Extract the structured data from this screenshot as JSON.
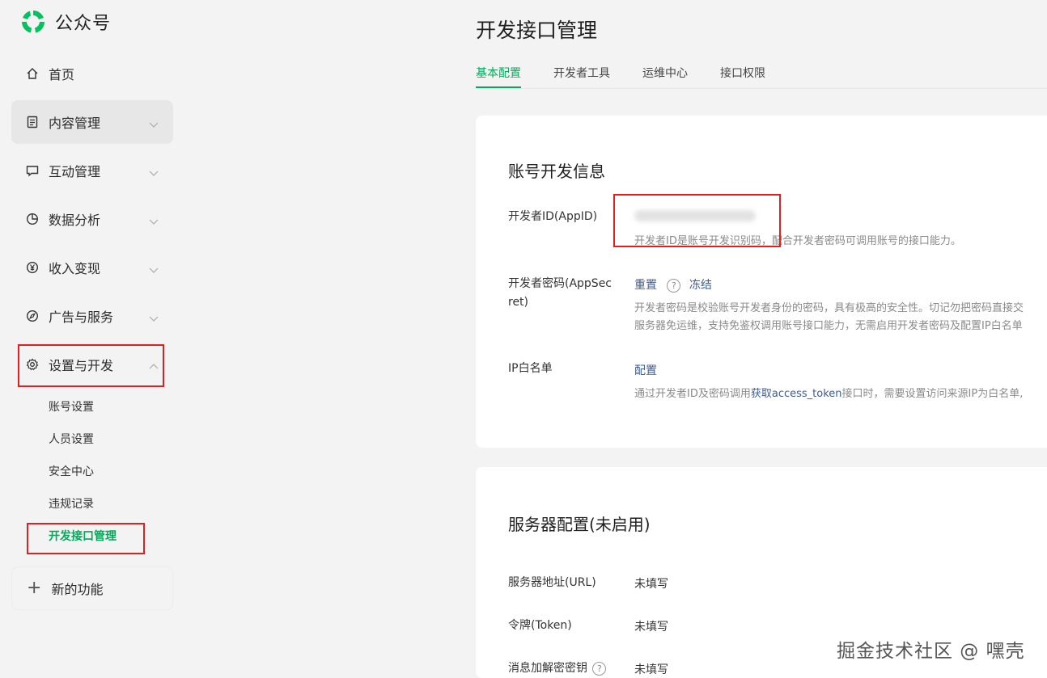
{
  "app": {
    "name": "公众号",
    "brand_color": "#07a85b"
  },
  "sidebar": {
    "items": [
      {
        "label": "首页",
        "icon": "home-icon"
      },
      {
        "label": "内容管理",
        "icon": "document-icon"
      },
      {
        "label": "互动管理",
        "icon": "chat-icon"
      },
      {
        "label": "数据分析",
        "icon": "pie-chart-icon"
      },
      {
        "label": "收入变现",
        "icon": "yen-icon"
      },
      {
        "label": "广告与服务",
        "icon": "compass-icon"
      },
      {
        "label": "设置与开发",
        "icon": "gear-icon"
      }
    ],
    "sub_items": [
      "账号设置",
      "人员设置",
      "安全中心",
      "违规记录",
      "开发接口管理"
    ],
    "new_feature": "新的功能"
  },
  "main": {
    "title": "开发接口管理",
    "tabs": [
      "基本配置",
      "开发者工具",
      "运维中心",
      "接口权限"
    ],
    "account_card": {
      "title": "账号开发信息",
      "appid_label": "开发者ID(AppID)",
      "appid_desc": "开发者ID是账号开发识别码，配合开发者密码可调用账号的接口能力。",
      "secret_label_1": "开发者密码(AppSec",
      "secret_label_2": "ret)",
      "reset": "重置",
      "freeze": "冻结",
      "secret_desc_1": "开发者密码是校验账号开发者身份的密码，具有极高的安全性。切记勿把密码直接交",
      "secret_desc_2": "服务器免运维，支持免鉴权调用账号接口能力，无需启用开发者密码及配置IP白名单",
      "ip_label": "IP白名单",
      "ip_config": "配置",
      "ip_desc_1": "通过开发者ID及密码调用",
      "ip_desc_link": "获取access_token",
      "ip_desc_2": "接口时，需要设置访问来源IP为白名单,"
    },
    "server_card": {
      "title": "服务器配置(未启用)",
      "url_label": "服务器地址(URL)",
      "url_value": "未填写",
      "token_label": "令牌(Token)",
      "token_value": "未填写",
      "aes_label": "消息加解密密钥",
      "aes_value": "未填写"
    }
  },
  "watermark": "掘金技术社区 @ 嘿壳"
}
